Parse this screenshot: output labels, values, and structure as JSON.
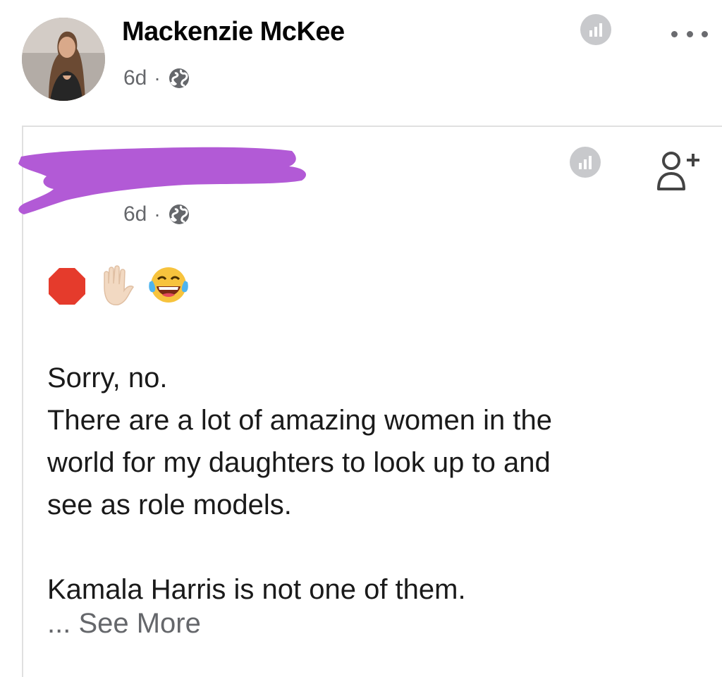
{
  "post": {
    "author": "Mackenzie McKee",
    "time": "6d",
    "separator": "·",
    "visibility_icon": "globe-icon",
    "stats_icon": "insights-icon",
    "more_icon": "more-options-icon"
  },
  "shared_post": {
    "author_redacted": true,
    "time": "6d",
    "separator": "·",
    "visibility_icon": "globe-icon",
    "stats_icon": "insights-icon",
    "add_friend_icon": "add-friend-icon",
    "reactions": [
      "stop-sign-emoji",
      "raised-hand-emoji",
      "tears-of-joy-emoji"
    ],
    "lines": [
      "Sorry, no.",
      "There are a lot of amazing women in the",
      "world for my daughters to look up to and",
      "see as role models.",
      "",
      "Kamala Harris is not one of them."
    ],
    "see_more": "... See More"
  },
  "colors": {
    "name": "#050505",
    "meta": "#65676b",
    "body": "#1a1a1a",
    "redaction": "#b25ad6",
    "stat_badge": "#c8c9cc"
  }
}
